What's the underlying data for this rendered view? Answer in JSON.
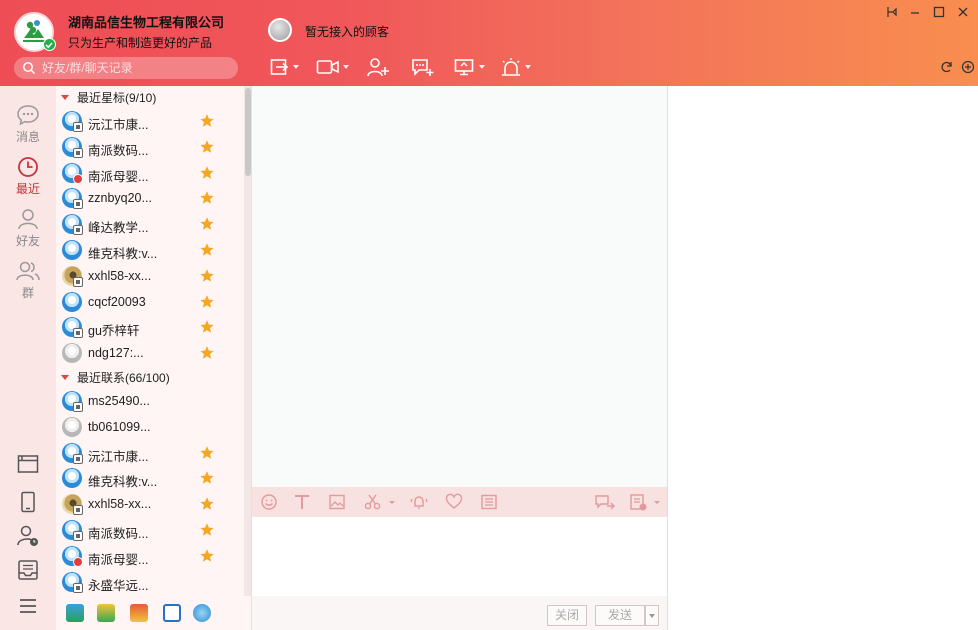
{
  "header": {
    "company_name": "湖南品信生物工程有限公司",
    "slogan": "只为生产和制造更好的产品",
    "customer_status": "暂无接入的顾客",
    "search_placeholder": "好友/群/聊天记录"
  },
  "nav": {
    "items": [
      {
        "label": "消息",
        "icon": "message-icon"
      },
      {
        "label": "最近",
        "icon": "clock-icon"
      },
      {
        "label": "好友",
        "icon": "person-icon"
      },
      {
        "label": "群",
        "icon": "group-icon"
      }
    ],
    "active_index": 1
  },
  "groups": [
    {
      "title": "最近星标(9/10)",
      "contacts": [
        {
          "name": "沅江市康...",
          "avatar": "blue",
          "mark": "mobile",
          "starred": true
        },
        {
          "name": "南派数码...",
          "avatar": "blue",
          "mark": "mobile",
          "starred": true
        },
        {
          "name": "南派母婴...",
          "avatar": "blue",
          "mark": "busy",
          "starred": true
        },
        {
          "name": "zznbyq20...",
          "avatar": "blue",
          "mark": "mobile",
          "starred": true
        },
        {
          "name": "峰达教学...",
          "avatar": "blue",
          "mark": "mobile",
          "starred": true
        },
        {
          "name": "维克科教:v...",
          "avatar": "blue",
          "mark": "",
          "starred": true
        },
        {
          "name": "xxhl58-xx...",
          "avatar": "photo",
          "mark": "mobile",
          "starred": true
        },
        {
          "name": "cqcf20093",
          "avatar": "blue",
          "mark": "",
          "starred": true
        },
        {
          "name": "gu乔梓轩",
          "avatar": "blue",
          "mark": "mobile",
          "starred": true
        },
        {
          "name": "ndg127:...",
          "avatar": "gray",
          "mark": "",
          "starred": true
        }
      ]
    },
    {
      "title": "最近联系(66/100)",
      "contacts": [
        {
          "name": "ms25490...",
          "avatar": "blue",
          "mark": "mobile",
          "starred": false
        },
        {
          "name": "tb061099...",
          "avatar": "gray",
          "mark": "",
          "starred": false
        },
        {
          "name": "沅江市康...",
          "avatar": "blue",
          "mark": "mobile",
          "starred": true
        },
        {
          "name": "维克科教:v...",
          "avatar": "blue",
          "mark": "",
          "starred": true
        },
        {
          "name": "xxhl58-xx...",
          "avatar": "photo",
          "mark": "mobile",
          "starred": true
        },
        {
          "name": "南派数码...",
          "avatar": "blue",
          "mark": "mobile",
          "starred": true
        },
        {
          "name": "南派母婴...",
          "avatar": "blue",
          "mark": "busy",
          "starred": true
        },
        {
          "name": "永盛华远...",
          "avatar": "blue",
          "mark": "mobile",
          "starred": false
        }
      ]
    }
  ],
  "chat": {
    "close_label": "关闭",
    "send_label": "发送"
  },
  "colors": {
    "header_start": "#ee4d55",
    "header_end": "#f98e4f",
    "star": "#f5a623",
    "accent": "#c8323a"
  }
}
